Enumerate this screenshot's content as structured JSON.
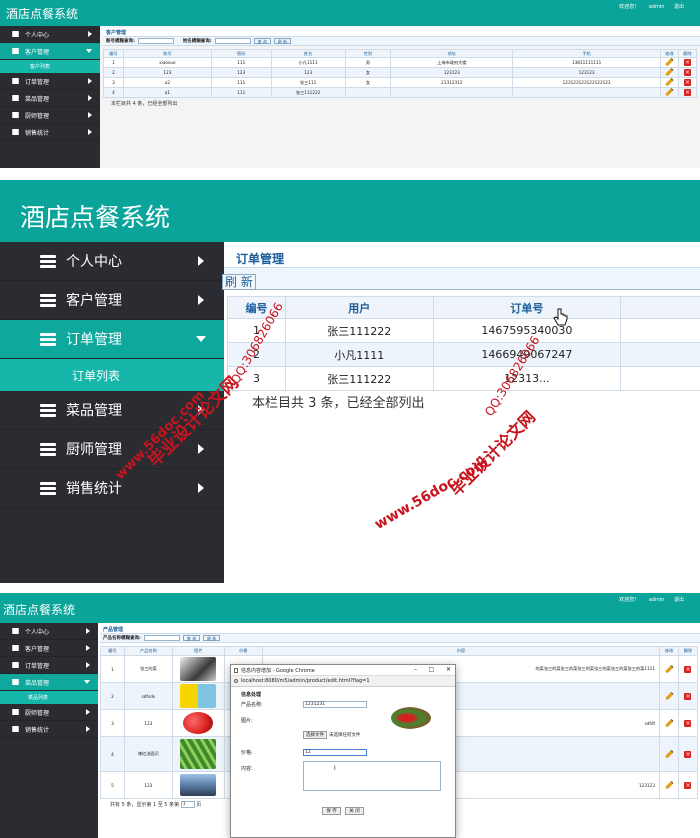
{
  "app_title": "酒店点餐系统",
  "top_right": {
    "welcome": "欢迎您！",
    "user": "admin",
    "logout": "退出"
  },
  "menu": [
    {
      "label": "个人中心"
    },
    {
      "label": "客户管理"
    },
    {
      "label": "订单管理"
    },
    {
      "label": "菜品管理"
    },
    {
      "label": "厨师管理"
    },
    {
      "label": "销售统计"
    }
  ],
  "panel1": {
    "title": "客户管理",
    "search1_label": "账号模糊查询:",
    "search2_label": "姓名模糊查询:",
    "btn_search": "查 询",
    "btn_refresh": "刷 新",
    "submenu": "客户列表",
    "columns": [
      "编号",
      "账号",
      "密码",
      "姓名",
      "性别",
      "地址",
      "手机",
      "修改",
      "删除"
    ],
    "rows": [
      [
        "1",
        "xiaoxue",
        "111",
        "小凡1111",
        "男",
        "上海市政府大楼",
        "13811111111"
      ],
      [
        "2",
        "123",
        "123",
        "123",
        "女",
        "123123",
        "123123"
      ],
      [
        "3",
        "a2",
        "111",
        "张三111",
        "女",
        "21312312",
        "123123123123123123"
      ],
      [
        "4",
        "a1",
        "111",
        "张三111222",
        "",
        "",
        ""
      ]
    ],
    "footer": "本栏目共 4 条，已经全部列出"
  },
  "panel2": {
    "title": "订单管理",
    "btn_refresh": "刷 新",
    "submenu": "订单列表",
    "columns": [
      "编号",
      "用户",
      "订单号"
    ],
    "rows": [
      [
        "1",
        "张三111222",
        "1467595340030"
      ],
      [
        "2",
        "小凡1111",
        "1466949067247"
      ],
      [
        "3",
        "张三111222",
        "12313..."
      ]
    ],
    "footer": "本栏目共 3 条，已经全部列出",
    "watermarks": [
      "毕业设计论文网",
      "www.56doc.com",
      "QQ:306826066"
    ]
  },
  "panel3": {
    "title": "产品管理",
    "search_label": "产品名称模糊查询:",
    "btn_search": "查 询",
    "btn_refresh": "刷 新",
    "submenu": "菜品列表",
    "columns": [
      "编号",
      "产品名称",
      "图片",
      "价格",
      "内容",
      "修改",
      "删除"
    ],
    "rows": [
      {
        "id": "1",
        "name": "张三的菜",
        "content": "的菜张三的菜张三的菜张三的菜张三的菜张三的菜张三的菜1111"
      },
      {
        "id": "2",
        "name": "sdfsdv",
        "content": ""
      },
      {
        "id": "3",
        "name": "123",
        "content": "sdfdf"
      },
      {
        "id": "4",
        "name": "辣红油面贝",
        "content": ""
      },
      {
        "id": "5",
        "name": "123",
        "content": "123123"
      }
    ],
    "pagination": "共有 5 条，显示第 1 至 5 条第",
    "page_suffix": "页",
    "page_input": "1",
    "food_colors": [
      "#3a3a3a",
      "#f5d600",
      "#d62020",
      "#3f8a2e",
      "#5a7ea8"
    ],
    "popup": {
      "window_title": "信息内容增加 - Google Chrome",
      "url": "localhost:8080/m5/admin/product/edit.html?flag=1",
      "heading": "信息处理",
      "name_label": "产品名称:",
      "name_value": "1231231",
      "image_label": "图片:",
      "file_btn": "选择文件",
      "file_status": "未选择任何文件",
      "price_label": "价格:",
      "price_value": "12",
      "content_label": "内容:",
      "save": "保 存",
      "close": "关 闭"
    }
  }
}
